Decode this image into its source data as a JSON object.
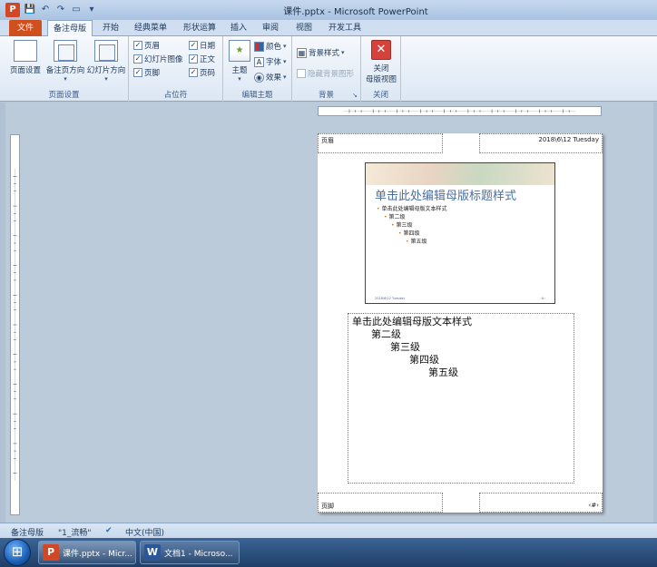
{
  "window": {
    "title": "课件.pptx - Microsoft PowerPoint",
    "app_icon_letter": "P"
  },
  "tabs": [
    {
      "label": "文件"
    },
    {
      "label": "备注母版"
    },
    {
      "label": "开始"
    },
    {
      "label": "经典菜单"
    },
    {
      "label": "形状运算"
    },
    {
      "label": "插入"
    },
    {
      "label": "审阅"
    },
    {
      "label": "视图"
    },
    {
      "label": "开发工具"
    }
  ],
  "ribbon": {
    "page_setup": {
      "label": "页面设置",
      "buttons": [
        "页面设置",
        "备注页方向",
        "幻灯片方向"
      ]
    },
    "placeholders": {
      "label": "占位符",
      "checks": [
        "页眉",
        "日期",
        "幻灯片图像",
        "正文",
        "页脚",
        "页码"
      ]
    },
    "edit_theme": {
      "label": "编辑主题",
      "theme": "主题",
      "colors": "颜色",
      "fonts": "字体",
      "effects": "效果"
    },
    "background": {
      "label": "背景",
      "styles": "背景样式",
      "hide_graphics": "隐藏背景图形"
    },
    "close": {
      "label": "关闭",
      "line1": "关闭",
      "line2": "母版视图"
    }
  },
  "page": {
    "header": "页眉",
    "date": "2018\\6\\12 Tuesday",
    "footer": "页脚",
    "page_num": "‹#›",
    "slide": {
      "title": "单击此处编辑母版标题样式",
      "levels": [
        "单击此处编辑母版文本样式",
        "第二级",
        "第三级",
        "第四级",
        "第五级"
      ],
      "footer": "2018\\6\\12 Tuesday",
      "num": "‹#›"
    },
    "notes_levels": [
      "单击此处编辑母版文本样式",
      "第二级",
      "第三级",
      "第四级",
      "第五级"
    ]
  },
  "statusbar": {
    "view": "备注母版",
    "theme": "\"1_流畅\"",
    "language": "中文(中国)"
  },
  "taskbar": {
    "items": [
      {
        "label": "课件.pptx - Micr...",
        "icon": "P",
        "color": "#d24726"
      },
      {
        "label": "文档1 - Microso...",
        "icon": "W",
        "color": "#2b579a"
      }
    ]
  }
}
